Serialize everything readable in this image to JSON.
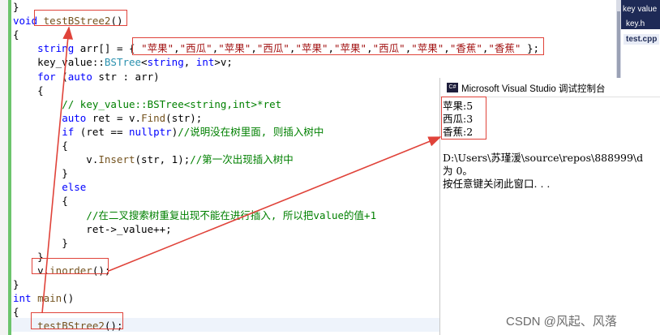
{
  "editor": {
    "lines": [
      {
        "segs": [
          {
            "t": "}",
            "c": ""
          }
        ]
      },
      {
        "segs": [
          {
            "t": "void ",
            "c": "kw"
          },
          {
            "t": "testBStree2",
            "c": "fn"
          },
          {
            "t": "()",
            "c": ""
          }
        ]
      },
      {
        "segs": [
          {
            "t": "{",
            "c": ""
          }
        ]
      },
      {
        "segs": [
          {
            "t": "    ",
            "c": ""
          },
          {
            "t": "string",
            "c": "kw"
          },
          {
            "t": " arr[] = { ",
            "c": ""
          },
          {
            "t": "\"苹果\"",
            "c": "str"
          },
          {
            "t": ",",
            "c": ""
          },
          {
            "t": "\"西瓜\"",
            "c": "str"
          },
          {
            "t": ",",
            "c": ""
          },
          {
            "t": "\"苹果\"",
            "c": "str"
          },
          {
            "t": ",",
            "c": ""
          },
          {
            "t": "\"西瓜\"",
            "c": "str"
          },
          {
            "t": ",",
            "c": ""
          },
          {
            "t": "\"苹果\"",
            "c": "str"
          },
          {
            "t": ",",
            "c": ""
          },
          {
            "t": "\"苹果\"",
            "c": "str"
          },
          {
            "t": ",",
            "c": ""
          },
          {
            "t": "\"西瓜\"",
            "c": "str"
          },
          {
            "t": ",",
            "c": ""
          },
          {
            "t": "\"苹果\"",
            "c": "str"
          },
          {
            "t": ",",
            "c": ""
          },
          {
            "t": "\"香蕉\"",
            "c": "str"
          },
          {
            "t": ",",
            "c": ""
          },
          {
            "t": "\"香蕉\"",
            "c": "str"
          },
          {
            "t": " };",
            "c": ""
          }
        ]
      },
      {
        "segs": [
          {
            "t": "    key_value::",
            "c": ""
          },
          {
            "t": "BSTree",
            "c": "ty"
          },
          {
            "t": "<",
            "c": ""
          },
          {
            "t": "string",
            "c": "kw"
          },
          {
            "t": ", ",
            "c": ""
          },
          {
            "t": "int",
            "c": "kw"
          },
          {
            "t": ">v;",
            "c": ""
          }
        ]
      },
      {
        "segs": [
          {
            "t": "    ",
            "c": ""
          },
          {
            "t": "for",
            "c": "kw"
          },
          {
            "t": " (",
            "c": ""
          },
          {
            "t": "auto",
            "c": "kw"
          },
          {
            "t": " str : arr)",
            "c": ""
          }
        ]
      },
      {
        "segs": [
          {
            "t": "    {",
            "c": ""
          }
        ]
      },
      {
        "segs": [
          {
            "t": "        ",
            "c": ""
          },
          {
            "t": "// key_value::BSTree<string,int>*ret",
            "c": "cm"
          }
        ]
      },
      {
        "segs": [
          {
            "t": "        ",
            "c": ""
          },
          {
            "t": "auto",
            "c": "kw"
          },
          {
            "t": " ret = v.",
            "c": ""
          },
          {
            "t": "Find",
            "c": "fn"
          },
          {
            "t": "(str);",
            "c": ""
          }
        ]
      },
      {
        "segs": [
          {
            "t": "        ",
            "c": ""
          },
          {
            "t": "if",
            "c": "kw"
          },
          {
            "t": " (ret == ",
            "c": ""
          },
          {
            "t": "nullptr",
            "c": "kw"
          },
          {
            "t": ")",
            "c": ""
          },
          {
            "t": "//说明没在树里面, 则插入树中",
            "c": "cm"
          }
        ]
      },
      {
        "segs": [
          {
            "t": "        {",
            "c": ""
          }
        ]
      },
      {
        "segs": [
          {
            "t": "            v.",
            "c": ""
          },
          {
            "t": "Insert",
            "c": "fn"
          },
          {
            "t": "(str, 1);",
            "c": ""
          },
          {
            "t": "//第一次出现插入树中",
            "c": "cm"
          }
        ]
      },
      {
        "segs": [
          {
            "t": "        }",
            "c": ""
          }
        ]
      },
      {
        "segs": [
          {
            "t": "        ",
            "c": ""
          },
          {
            "t": "else",
            "c": "kw"
          }
        ]
      },
      {
        "segs": [
          {
            "t": "        {",
            "c": ""
          }
        ]
      },
      {
        "segs": [
          {
            "t": "            ",
            "c": ""
          },
          {
            "t": "//在二叉搜索树重复出现不能在进行插入, 所以把value的值+1",
            "c": "cm"
          }
        ]
      },
      {
        "segs": [
          {
            "t": "            ret->_value++;",
            "c": ""
          }
        ]
      },
      {
        "segs": [
          {
            "t": "        }",
            "c": ""
          }
        ]
      },
      {
        "segs": [
          {
            "t": "    }",
            "c": ""
          }
        ]
      },
      {
        "segs": [
          {
            "t": "    v.",
            "c": ""
          },
          {
            "t": "inorder",
            "c": "fn"
          },
          {
            "t": "();",
            "c": ""
          }
        ]
      },
      {
        "segs": [
          {
            "t": "}",
            "c": ""
          }
        ]
      },
      {
        "segs": [
          {
            "t": "int",
            "c": "kw"
          },
          {
            "t": " ",
            "c": ""
          },
          {
            "t": "main",
            "c": "fn"
          },
          {
            "t": "()",
            "c": ""
          }
        ]
      },
      {
        "segs": [
          {
            "t": "{",
            "c": ""
          }
        ]
      },
      {
        "segs": [
          {
            "t": "    ",
            "c": ""
          },
          {
            "t": "testBStree2",
            "c": "fn"
          },
          {
            "t": "();",
            "c": ""
          }
        ]
      }
    ]
  },
  "solution_explorer": {
    "items": [
      "key value",
      "key.h",
      "test.cpp"
    ]
  },
  "console": {
    "title": "Microsoft Visual Studio 调试控制台",
    "icon_label": "C#",
    "output": [
      "苹果:5",
      "西瓜:3",
      "香蕉:2",
      "",
      "D:\\Users\\苏瑾湲\\source\\repos\\888999\\d",
      "为 0。",
      "按任意键关闭此窗口. . ."
    ]
  },
  "watermark": "CSDN @风起、风落",
  "colors": {
    "annotation": "#e0433a",
    "keyword": "#0000ff",
    "string": "#a31515",
    "comment": "#008000",
    "type": "#2b91af"
  }
}
